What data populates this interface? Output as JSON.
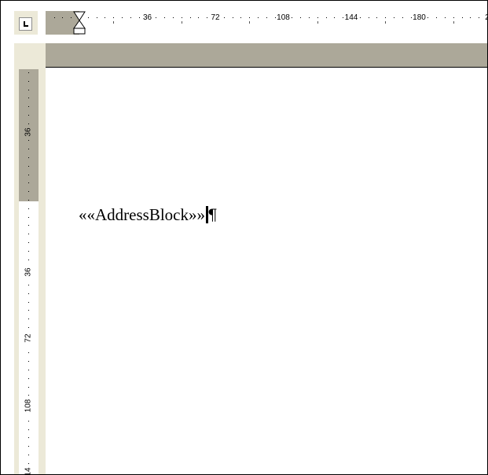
{
  "horizontal_ruler": {
    "labels": [
      "36",
      "72",
      "108",
      "144",
      "180",
      "2"
    ]
  },
  "vertical_ruler": {
    "labels": [
      "36",
      "36",
      "72",
      "108",
      "14"
    ]
  },
  "document": {
    "merge_field": "««AddressBlock»»",
    "paragraph_mark": "¶"
  },
  "icons": {
    "tab_selector": "left-tab-icon",
    "indent": "hourglass-indent-icon"
  },
  "colors": {
    "ruler_margin": "#aca899",
    "chrome_background": "#ece9d8",
    "page": "#ffffff"
  }
}
